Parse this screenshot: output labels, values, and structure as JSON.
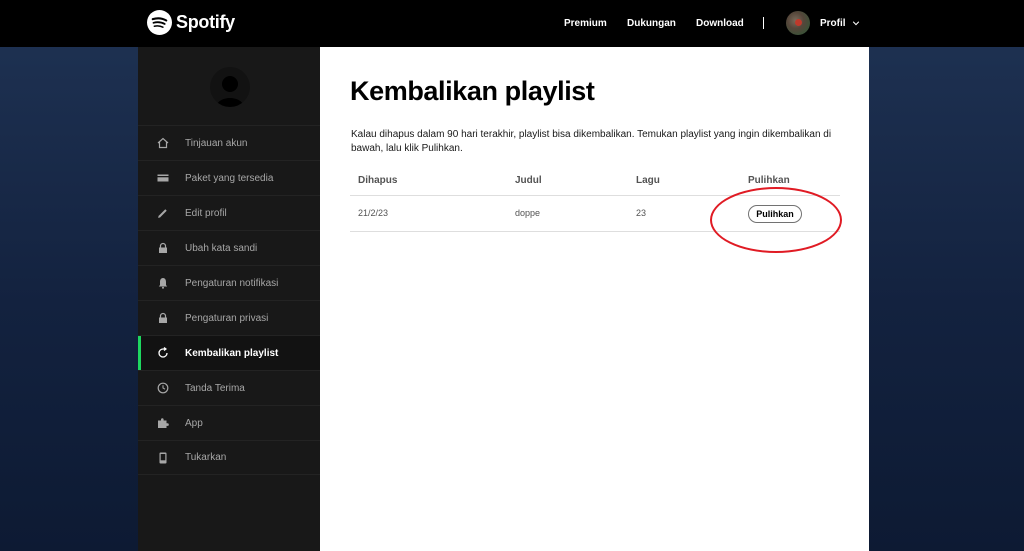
{
  "header": {
    "logo_text": "Spotify",
    "nav": [
      "Premium",
      "Dukungan",
      "Download"
    ],
    "profile_label": "Profil"
  },
  "sidebar": {
    "items": [
      {
        "label": "Tinjauan akun",
        "icon": "home-icon"
      },
      {
        "label": "Paket yang tersedia",
        "icon": "card-icon"
      },
      {
        "label": "Edit profil",
        "icon": "pencil-icon"
      },
      {
        "label": "Ubah kata sandi",
        "icon": "lock-icon"
      },
      {
        "label": "Pengaturan notifikasi",
        "icon": "bell-icon"
      },
      {
        "label": "Pengaturan privasi",
        "icon": "lock-icon"
      },
      {
        "label": "Kembalikan playlist",
        "icon": "refresh-icon",
        "active": true
      },
      {
        "label": "Tanda Terima",
        "icon": "clock-icon"
      },
      {
        "label": "App",
        "icon": "puzzle-icon"
      },
      {
        "label": "Tukarkan",
        "icon": "phone-icon"
      }
    ]
  },
  "main": {
    "title": "Kembalikan playlist",
    "description": "Kalau dihapus dalam 90 hari terakhir, playlist bisa dikembalikan. Temukan playlist yang ingin dikembalikan di bawah, lalu klik Pulihkan.",
    "table": {
      "headers": [
        "Dihapus",
        "Judul",
        "Lagu",
        "Pulihkan"
      ],
      "rows": [
        {
          "deleted": "21/2/23",
          "title": "doppe",
          "songs": "23",
          "action": "Pulihkan"
        }
      ]
    }
  },
  "colors": {
    "accent": "#1ed760",
    "annotation": "#e01b24",
    "sidebar_bg": "#181818",
    "topbar_bg": "#000000"
  }
}
